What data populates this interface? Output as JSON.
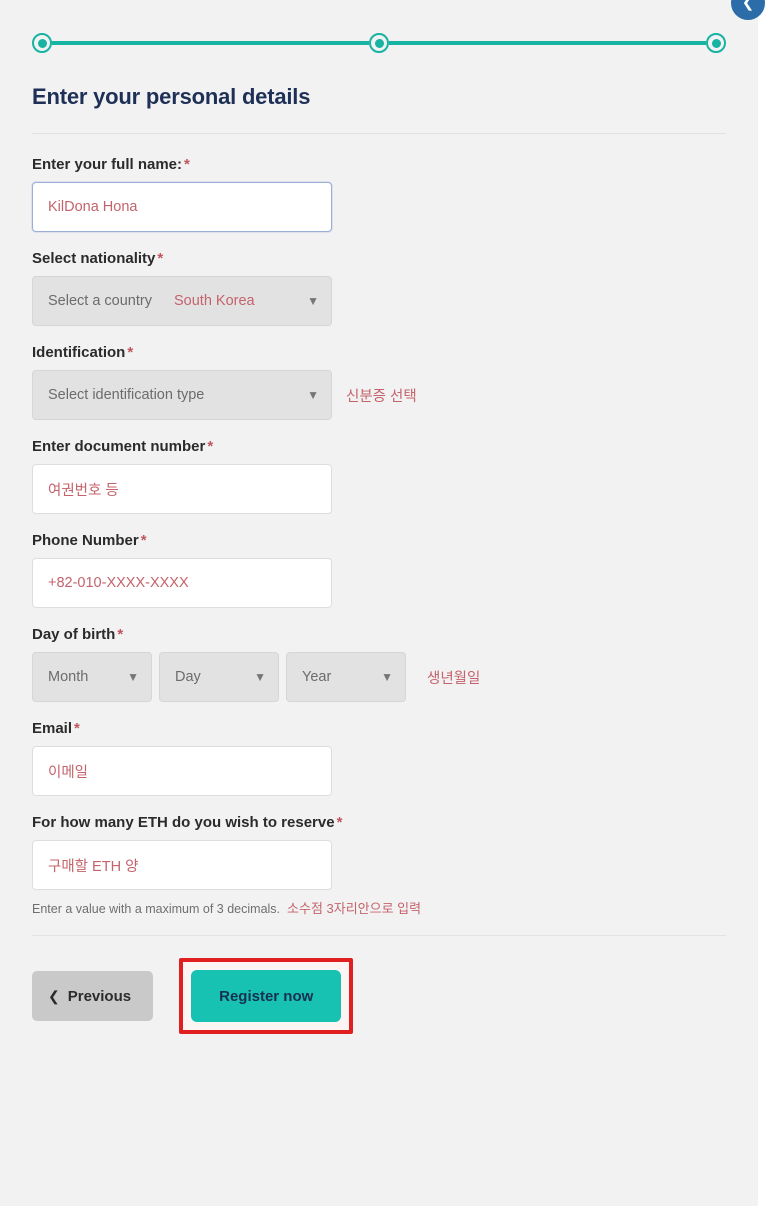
{
  "stepper": {
    "steps": [
      {
        "name": "step-1",
        "state": "complete"
      },
      {
        "name": "step-2",
        "state": "complete"
      },
      {
        "name": "step-3",
        "state": "current"
      }
    ]
  },
  "heading": {
    "title": "Enter your personal details"
  },
  "form": {
    "full_name": {
      "label": "Enter your full name:",
      "required_marker": "*",
      "value": "KilDona Hona"
    },
    "nationality": {
      "label": "Select nationality",
      "required_marker": "*",
      "selected": "Select a country",
      "annotation": "South Korea",
      "chevron": "chevron-down"
    },
    "identification": {
      "label": "Identification",
      "required_marker": "*",
      "selected": "Select identification type",
      "annotation": "신분증 선택",
      "chevron": "chevron-down"
    },
    "document_number": {
      "label": "Enter document number",
      "required_marker": "*",
      "placeholder": "여권번호 등"
    },
    "phone": {
      "label": "Phone Number",
      "required_marker": "*",
      "placeholder": "+82-010-XXXX-XXXX"
    },
    "day_of_birth": {
      "label": "Day of birth",
      "required_marker": "*",
      "month": "Month",
      "day": "Day",
      "year": "Year",
      "annotation": "생년월일",
      "chevron": "chevron-down"
    },
    "email": {
      "label": "Email",
      "required_marker": "*",
      "placeholder": "이메일"
    },
    "eth_amount": {
      "label": "For how many ETH do you wish to reserve",
      "required_marker": "*",
      "placeholder": "구매할 ETH 양",
      "helper": "Enter a value with a maximum of 3 decimals.",
      "helper_annotation": "소수점 3자리안으로 입력"
    }
  },
  "actions": {
    "previous_label": "Previous",
    "previous_icon": "chevron-left",
    "register_label": "Register now"
  },
  "scroll_badge": {
    "icon": "chevron-up"
  },
  "colors": {
    "accent_teal": "#17b3a3",
    "register_teal": "#17c2b3",
    "heading_navy": "#1f3057",
    "annotation_red": "#c4636b",
    "highlight_red": "#e02020",
    "page_background": "#f2f2f2"
  }
}
